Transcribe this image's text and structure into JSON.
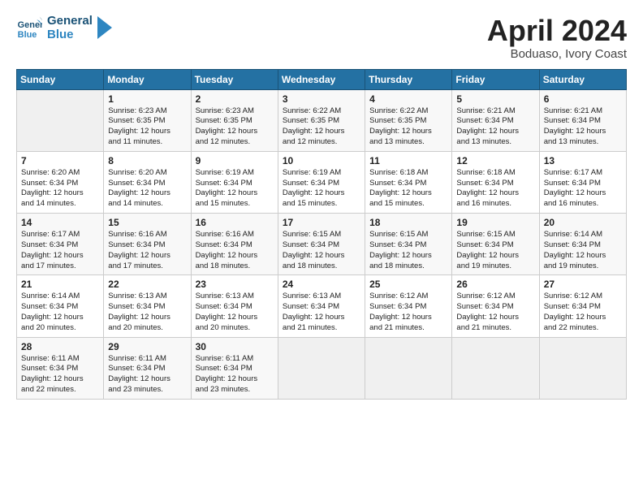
{
  "logo": {
    "line1": "General",
    "line2": "Blue"
  },
  "title": "April 2024",
  "subtitle": "Boduaso, Ivory Coast",
  "days_of_week": [
    "Sunday",
    "Monday",
    "Tuesday",
    "Wednesday",
    "Thursday",
    "Friday",
    "Saturday"
  ],
  "weeks": [
    [
      {
        "num": "",
        "info": ""
      },
      {
        "num": "1",
        "info": "Sunrise: 6:23 AM\nSunset: 6:35 PM\nDaylight: 12 hours\nand 11 minutes."
      },
      {
        "num": "2",
        "info": "Sunrise: 6:23 AM\nSunset: 6:35 PM\nDaylight: 12 hours\nand 12 minutes."
      },
      {
        "num": "3",
        "info": "Sunrise: 6:22 AM\nSunset: 6:35 PM\nDaylight: 12 hours\nand 12 minutes."
      },
      {
        "num": "4",
        "info": "Sunrise: 6:22 AM\nSunset: 6:35 PM\nDaylight: 12 hours\nand 13 minutes."
      },
      {
        "num": "5",
        "info": "Sunrise: 6:21 AM\nSunset: 6:34 PM\nDaylight: 12 hours\nand 13 minutes."
      },
      {
        "num": "6",
        "info": "Sunrise: 6:21 AM\nSunset: 6:34 PM\nDaylight: 12 hours\nand 13 minutes."
      }
    ],
    [
      {
        "num": "7",
        "info": "Sunrise: 6:20 AM\nSunset: 6:34 PM\nDaylight: 12 hours\nand 14 minutes."
      },
      {
        "num": "8",
        "info": "Sunrise: 6:20 AM\nSunset: 6:34 PM\nDaylight: 12 hours\nand 14 minutes."
      },
      {
        "num": "9",
        "info": "Sunrise: 6:19 AM\nSunset: 6:34 PM\nDaylight: 12 hours\nand 15 minutes."
      },
      {
        "num": "10",
        "info": "Sunrise: 6:19 AM\nSunset: 6:34 PM\nDaylight: 12 hours\nand 15 minutes."
      },
      {
        "num": "11",
        "info": "Sunrise: 6:18 AM\nSunset: 6:34 PM\nDaylight: 12 hours\nand 15 minutes."
      },
      {
        "num": "12",
        "info": "Sunrise: 6:18 AM\nSunset: 6:34 PM\nDaylight: 12 hours\nand 16 minutes."
      },
      {
        "num": "13",
        "info": "Sunrise: 6:17 AM\nSunset: 6:34 PM\nDaylight: 12 hours\nand 16 minutes."
      }
    ],
    [
      {
        "num": "14",
        "info": "Sunrise: 6:17 AM\nSunset: 6:34 PM\nDaylight: 12 hours\nand 17 minutes."
      },
      {
        "num": "15",
        "info": "Sunrise: 6:16 AM\nSunset: 6:34 PM\nDaylight: 12 hours\nand 17 minutes."
      },
      {
        "num": "16",
        "info": "Sunrise: 6:16 AM\nSunset: 6:34 PM\nDaylight: 12 hours\nand 18 minutes."
      },
      {
        "num": "17",
        "info": "Sunrise: 6:15 AM\nSunset: 6:34 PM\nDaylight: 12 hours\nand 18 minutes."
      },
      {
        "num": "18",
        "info": "Sunrise: 6:15 AM\nSunset: 6:34 PM\nDaylight: 12 hours\nand 18 minutes."
      },
      {
        "num": "19",
        "info": "Sunrise: 6:15 AM\nSunset: 6:34 PM\nDaylight: 12 hours\nand 19 minutes."
      },
      {
        "num": "20",
        "info": "Sunrise: 6:14 AM\nSunset: 6:34 PM\nDaylight: 12 hours\nand 19 minutes."
      }
    ],
    [
      {
        "num": "21",
        "info": "Sunrise: 6:14 AM\nSunset: 6:34 PM\nDaylight: 12 hours\nand 20 minutes."
      },
      {
        "num": "22",
        "info": "Sunrise: 6:13 AM\nSunset: 6:34 PM\nDaylight: 12 hours\nand 20 minutes."
      },
      {
        "num": "23",
        "info": "Sunrise: 6:13 AM\nSunset: 6:34 PM\nDaylight: 12 hours\nand 20 minutes."
      },
      {
        "num": "24",
        "info": "Sunrise: 6:13 AM\nSunset: 6:34 PM\nDaylight: 12 hours\nand 21 minutes."
      },
      {
        "num": "25",
        "info": "Sunrise: 6:12 AM\nSunset: 6:34 PM\nDaylight: 12 hours\nand 21 minutes."
      },
      {
        "num": "26",
        "info": "Sunrise: 6:12 AM\nSunset: 6:34 PM\nDaylight: 12 hours\nand 21 minutes."
      },
      {
        "num": "27",
        "info": "Sunrise: 6:12 AM\nSunset: 6:34 PM\nDaylight: 12 hours\nand 22 minutes."
      }
    ],
    [
      {
        "num": "28",
        "info": "Sunrise: 6:11 AM\nSunset: 6:34 PM\nDaylight: 12 hours\nand 22 minutes."
      },
      {
        "num": "29",
        "info": "Sunrise: 6:11 AM\nSunset: 6:34 PM\nDaylight: 12 hours\nand 23 minutes."
      },
      {
        "num": "30",
        "info": "Sunrise: 6:11 AM\nSunset: 6:34 PM\nDaylight: 12 hours\nand 23 minutes."
      },
      {
        "num": "",
        "info": ""
      },
      {
        "num": "",
        "info": ""
      },
      {
        "num": "",
        "info": ""
      },
      {
        "num": "",
        "info": ""
      }
    ]
  ]
}
